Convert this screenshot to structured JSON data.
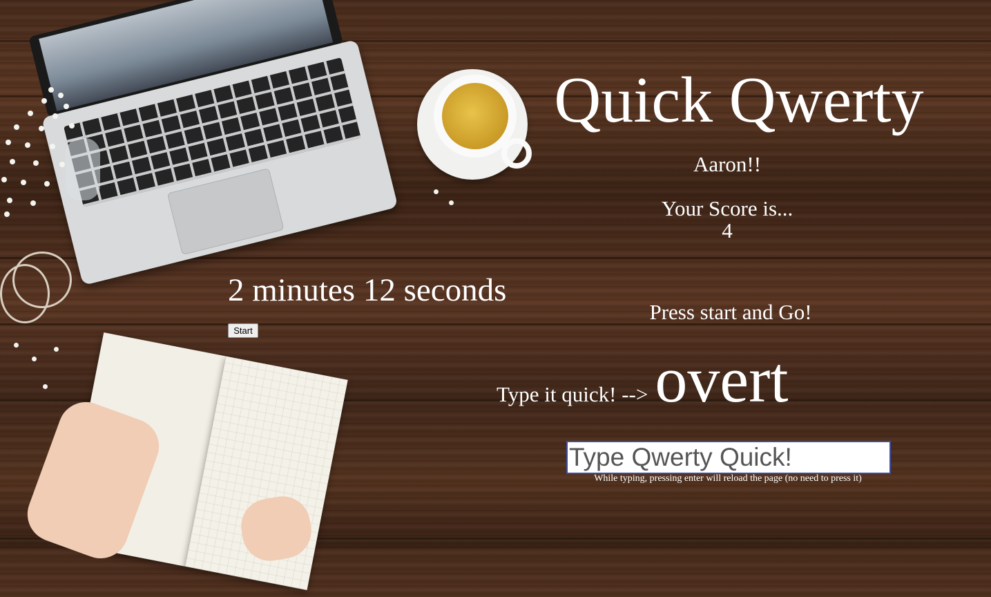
{
  "app": {
    "title": "Quick Qwerty",
    "player_name": "Aaron!!",
    "score_label": "Your Score is...",
    "score_value": "4"
  },
  "timer": {
    "display": "2 minutes 12 seconds"
  },
  "controls": {
    "start_label": "Start",
    "instruction": "Press start and Go!"
  },
  "prompt": {
    "label": "Type it quick! -->",
    "word": "overt"
  },
  "input": {
    "placeholder": "Type Qwerty Quick!",
    "value": ""
  },
  "hint": "While typing, pressing enter will reload the page (no need to press it)",
  "background": {
    "description_icons": [
      "laptop-icon",
      "tea-cup-icon",
      "flowers-icon",
      "bracelet-icon",
      "notebook-icon"
    ],
    "wood_color": "#4a2c1c",
    "input_border_color": "#3c4ea0"
  }
}
